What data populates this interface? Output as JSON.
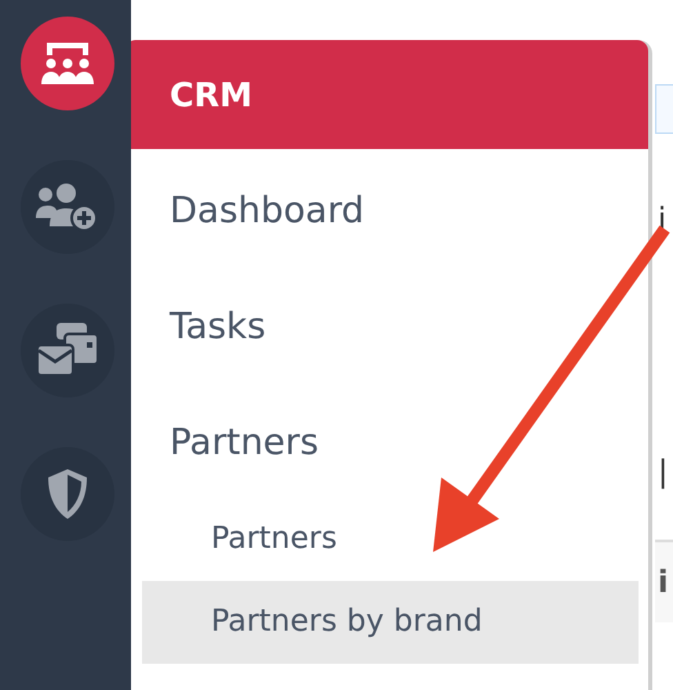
{
  "rail": {
    "items": [
      {
        "kind": "crm",
        "selected": true
      },
      {
        "kind": "contacts",
        "selected": false
      },
      {
        "kind": "messages",
        "selected": false
      },
      {
        "kind": "security",
        "selected": false
      }
    ]
  },
  "menu": {
    "title": "CRM",
    "items": [
      {
        "label": "Dashboard",
        "selected": false
      },
      {
        "label": "Tasks",
        "selected": false
      },
      {
        "label": "Partners",
        "selected": false,
        "children": [
          {
            "label": "Partners",
            "selected": false
          },
          {
            "label": "Partners by brand",
            "selected": true
          }
        ]
      }
    ]
  },
  "background": {
    "text_1": "i",
    "text_2": "|",
    "row_text": "i"
  }
}
